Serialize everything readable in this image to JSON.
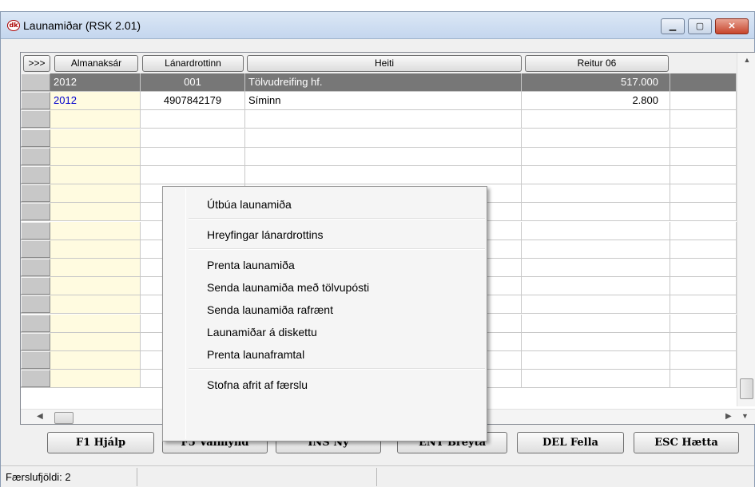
{
  "window": {
    "title": "Launamiðar (RSK 2.01)",
    "icon_label": "dk",
    "minimize": "▁",
    "maximize": "▢",
    "close": "✕"
  },
  "grid": {
    "headers": {
      "expand": ">>>",
      "year": "Almanaksár",
      "creditor": "Lánardrottinn",
      "name": "Heiti",
      "field06": "Reitur 06"
    },
    "rows": [
      {
        "year": "2012",
        "creditor": "001",
        "name": "Tölvudreifing hf.",
        "amount": "517.000",
        "selected": true
      },
      {
        "year": "2012",
        "creditor": "4907842179",
        "name": "Síminn",
        "amount": "2.800",
        "selected": false
      }
    ],
    "empty_row_count": 15
  },
  "context_menu": {
    "items": [
      {
        "label": "Útbúa launamiða",
        "group": 1
      },
      {
        "label": "Hreyfingar lánardrottins",
        "group": 2
      },
      {
        "label": "Prenta launamiða",
        "group": 3
      },
      {
        "label": "Senda launamiða með tölvupósti",
        "group": 3
      },
      {
        "label": "Senda launamiða rafrænt",
        "group": 3
      },
      {
        "label": "Launamiðar á diskettu",
        "group": 3
      },
      {
        "label": "Prenta launaframtal",
        "group": 3
      },
      {
        "label": "Stofna afrit af færslu",
        "group": 4
      }
    ]
  },
  "buttons": {
    "f1": "F1 Hjálp",
    "f5": "F5 Valmynd",
    "ins": "INS Ný",
    "ent": "ENT Breyta",
    "del": "DEL Fella",
    "esc": "ESC Hætta"
  },
  "status": {
    "record_count": "Færslufjöldi: 2"
  },
  "colors": {
    "selected_row": "#777777",
    "year_column_bg": "#fffbe0",
    "year_text": "#0000cc"
  }
}
